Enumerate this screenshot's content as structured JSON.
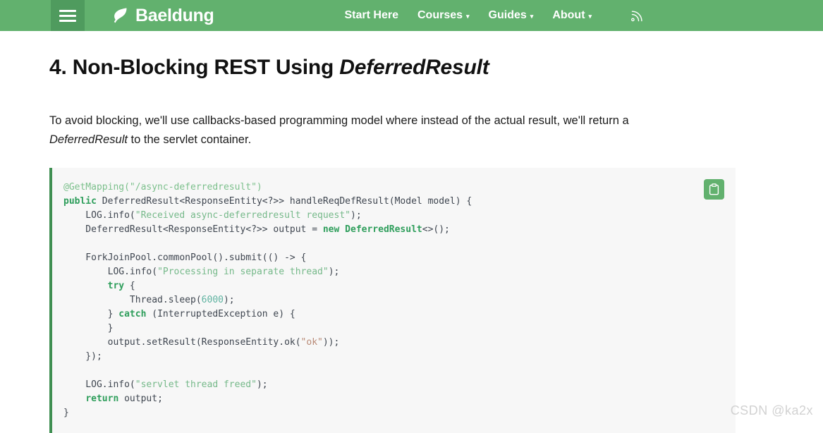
{
  "header": {
    "menu_toggle_label": "Menu",
    "brand_name": "Baeldung",
    "brand_logo_icon": "leaf-icon",
    "nav_items": [
      {
        "label": "Start Here",
        "has_dropdown": false
      },
      {
        "label": "Courses",
        "has_dropdown": true,
        "caret": "▾"
      },
      {
        "label": "Guides",
        "has_dropdown": true,
        "caret": "▾"
      },
      {
        "label": "About",
        "has_dropdown": true,
        "caret": "▾"
      }
    ],
    "rss_icon": "rss-feed-icon",
    "background_color": "#62b16e",
    "menu_toggle_color": "#4f9b5e"
  },
  "article": {
    "heading_number": "4.",
    "heading_text_before_em": " Non-Blocking REST Using ",
    "heading_em": "DeferredResult",
    "paragraph_part_1": "To avoid blocking, we'll use callbacks-based programming model where instead of the actual result, we'll return a ",
    "paragraph_em": "DeferredResult",
    "paragraph_part_2": " to the servlet container."
  },
  "code_block": {
    "language": "java",
    "accent_color": "#3f8f52",
    "background_color": "#f7f7f7",
    "copy_button_icon": "clipboard-icon",
    "copy_button_label": "Copy",
    "lines": [
      {
        "text": "@GetMapping(\"/async-deferredresult\")",
        "tokens": [
          {
            "t": "@GetMapping(\"/async-deferredresult\")",
            "c": "anno"
          }
        ]
      },
      {
        "text": "public DeferredResult<ResponseEntity<?>> handleReqDefResult(Model model) {",
        "tokens": [
          {
            "t": "public",
            "c": "kw"
          },
          {
            "t": " DeferredResult<ResponseEntity<?>> handleReqDefResult(Model model) {",
            "c": ""
          }
        ]
      },
      {
        "text": "    LOG.info(\"Received async-deferredresult request\");",
        "tokens": [
          {
            "t": "    LOG.info(",
            "c": ""
          },
          {
            "t": "\"Received async-deferredresult request\"",
            "c": "str"
          },
          {
            "t": ");",
            "c": ""
          }
        ]
      },
      {
        "text": "    DeferredResult<ResponseEntity<?>> output = new DeferredResult<>();",
        "tokens": [
          {
            "t": "    DeferredResult<ResponseEntity<?>> output = ",
            "c": ""
          },
          {
            "t": "new DeferredResult",
            "c": "kw"
          },
          {
            "t": "<>();",
            "c": ""
          }
        ]
      },
      {
        "text": "",
        "tokens": []
      },
      {
        "text": "    ForkJoinPool.commonPool().submit(() -> {",
        "tokens": [
          {
            "t": "    ForkJoinPool.commonPool().submit(() -> {",
            "c": ""
          }
        ]
      },
      {
        "text": "        LOG.info(\"Processing in separate thread\");",
        "tokens": [
          {
            "t": "        LOG.info(",
            "c": ""
          },
          {
            "t": "\"Processing in separate thread\"",
            "c": "str"
          },
          {
            "t": ");",
            "c": ""
          }
        ]
      },
      {
        "text": "        try {",
        "tokens": [
          {
            "t": "        ",
            "c": ""
          },
          {
            "t": "try",
            "c": "kw"
          },
          {
            "t": " {",
            "c": ""
          }
        ]
      },
      {
        "text": "            Thread.sleep(6000);",
        "tokens": [
          {
            "t": "            Thread.sleep(",
            "c": ""
          },
          {
            "t": "6000",
            "c": "num"
          },
          {
            "t": ");",
            "c": ""
          }
        ]
      },
      {
        "text": "        } catch (InterruptedException e) {",
        "tokens": [
          {
            "t": "        } ",
            "c": ""
          },
          {
            "t": "catch",
            "c": "kw"
          },
          {
            "t": " (InterruptedException e) {",
            "c": ""
          }
        ]
      },
      {
        "text": "        }",
        "tokens": [
          {
            "t": "        }",
            "c": ""
          }
        ]
      },
      {
        "text": "        output.setResult(ResponseEntity.ok(\"ok\"));",
        "tokens": [
          {
            "t": "        output.setResult(ResponseEntity.ok(",
            "c": ""
          },
          {
            "t": "\"ok\"",
            "c": "str-alt"
          },
          {
            "t": "));",
            "c": ""
          }
        ]
      },
      {
        "text": "    });",
        "tokens": [
          {
            "t": "    });",
            "c": ""
          }
        ]
      },
      {
        "text": "",
        "tokens": []
      },
      {
        "text": "    LOG.info(\"servlet thread freed\");",
        "tokens": [
          {
            "t": "    LOG.info(",
            "c": ""
          },
          {
            "t": "\"servlet thread freed\"",
            "c": "str"
          },
          {
            "t": ");",
            "c": ""
          }
        ]
      },
      {
        "text": "    return output;",
        "tokens": [
          {
            "t": "    ",
            "c": ""
          },
          {
            "t": "return",
            "c": "kw"
          },
          {
            "t": " output;",
            "c": ""
          }
        ]
      },
      {
        "text": "}",
        "tokens": [
          {
            "t": "}",
            "c": ""
          }
        ]
      }
    ]
  },
  "watermark": {
    "text": "CSDN @ka2x"
  }
}
